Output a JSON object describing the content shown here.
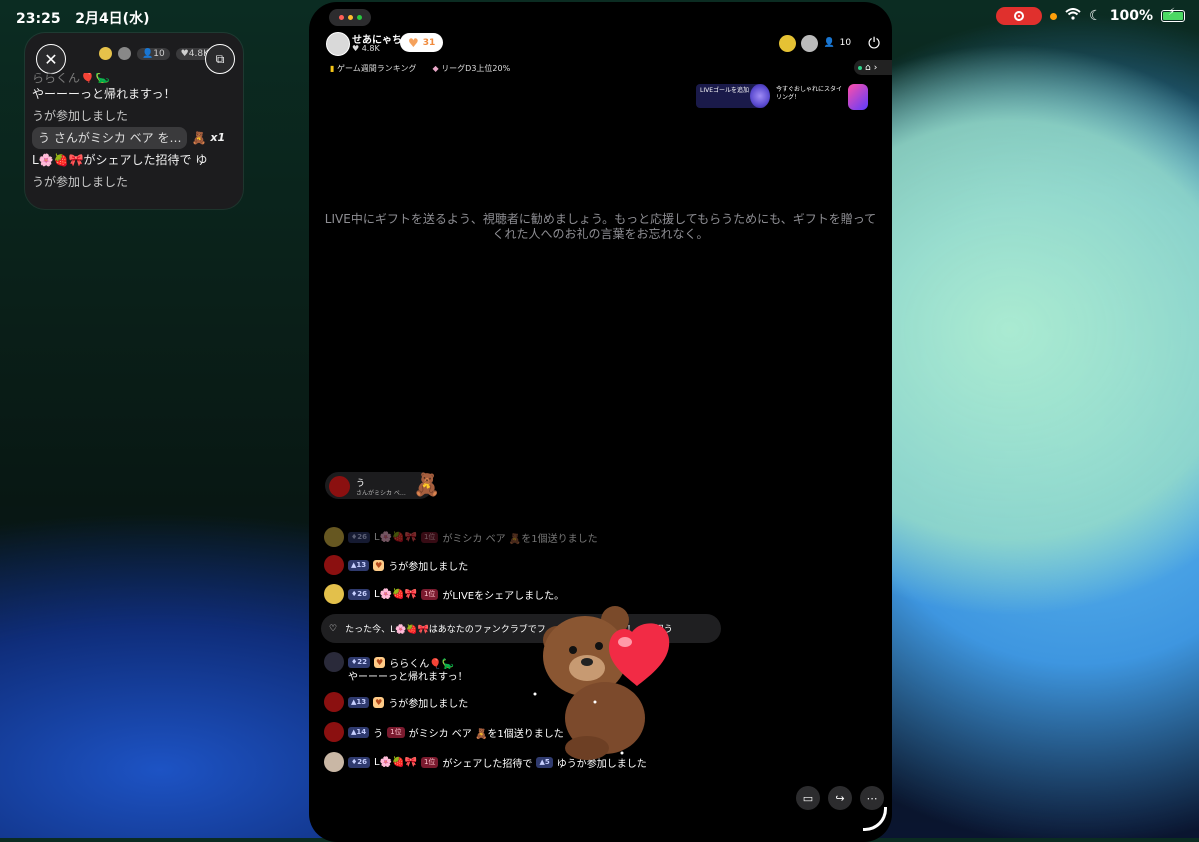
{
  "status_bar": {
    "time": "23:25",
    "date": "2月4日(水)",
    "battery": "100%",
    "icons": [
      "screen-record-icon",
      "wifi-icon",
      "moon-icon",
      "battery-charging-icon"
    ]
  },
  "pip": {
    "viewers": "10",
    "likes": "4.8K",
    "messages": [
      {
        "text": "ららくん🎈🦕",
        "faded": true
      },
      {
        "text": "やーーーっと帰れますっ！"
      },
      {
        "text": "うが参加しました"
      },
      {
        "text": "う さんがミシカ ベア を…",
        "gift": "🧸",
        "count": "x1"
      },
      {
        "text": "L🌸🍓🎀がシェアした招待で ゆ"
      },
      {
        "text": "うが参加しました"
      }
    ]
  },
  "stream": {
    "host_name": "せあにゃち",
    "host_likes": "4.8K",
    "heart_count": "31",
    "viewer_count": "10",
    "rank_weekly": "ゲーム週間ランキング",
    "rank_league": "リーグD3上位20%",
    "goal_card": "LIVEゴールを追加",
    "style_card": "今すぐおしゃれにスタイリング！",
    "hint": "LIVE中にギフトを送るよう、視聴者に勧めましょう。もっと応援してもらうためにも、ギフトを贈ってくれた人へのお礼の言葉をお忘れなく。",
    "gift_pill": {
      "name": "う",
      "sub": "さんがミシカ ベ…",
      "gift": "🧸"
    },
    "chat": [
      {
        "level": "26",
        "name": "L🌸🍓🎀",
        "rank": "1位",
        "text": "がミシカ ベア 🧸を1個送りました",
        "dim": true,
        "avatar": "#e3c04b"
      },
      {
        "level": "13",
        "fan": "♥",
        "text": "うが参加しました",
        "avatar": "#8b1010"
      },
      {
        "level": "26",
        "name": "L🌸🍓🎀",
        "rank": "1位",
        "text": "がLIVEをシェアしました。",
        "avatar": "#e3c04b"
      },
      {
        "level": "22",
        "fan": "♥",
        "name": "ららくん🎈🦕",
        "text2": "やーーーっと帰れますっ！",
        "avatar": "#2a2a3a"
      },
      {
        "level": "13",
        "fan": "♥",
        "text": "うが参加しました",
        "avatar": "#8b1010"
      },
      {
        "level": "14",
        "name": "う",
        "rank": "1位",
        "text": "がミシカ ベア 🧸を1個送りました",
        "avatar": "#8b1010"
      },
      {
        "level": "26",
        "name": "L🌸🍓🎀",
        "rank": "1位",
        "text": "がシェアした招待で",
        "level2": "5",
        "text3": "ゆうが参加しました",
        "avatar": "#c9b7a5"
      }
    ],
    "notice": "たった今、L🌸🍓🎀はあなたのファンクラブでフ………到達しました！",
    "notice_action": "祝う"
  }
}
